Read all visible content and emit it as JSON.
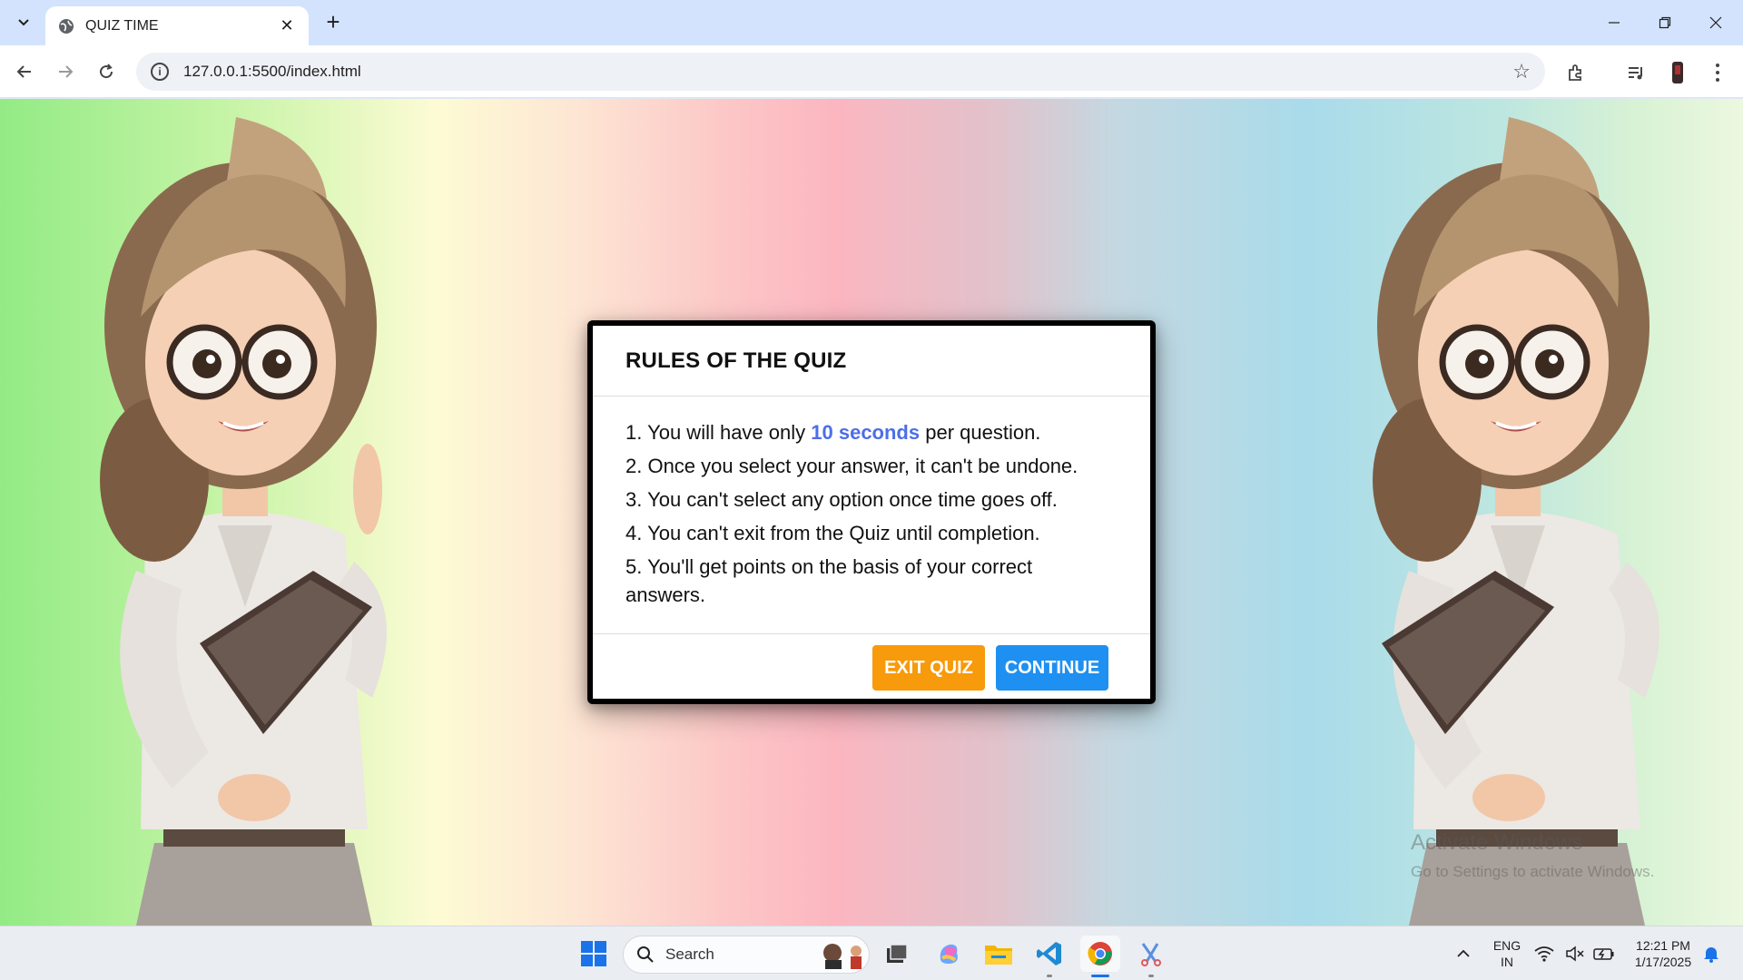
{
  "browser": {
    "tab_title": "QUIZ TIME",
    "url": "127.0.0.1:5500/index.html"
  },
  "modal": {
    "title": "RULES OF THE QUIZ",
    "rules": [
      {
        "before": "1. You will have only ",
        "highlight": "10 seconds",
        "after": " per question."
      },
      {
        "text": "2. Once you select your answer, it can't be undone."
      },
      {
        "text": "3. You can't select any option once time goes off."
      },
      {
        "text": "4. You can't exit from the Quiz until completion."
      },
      {
        "text": "5. You'll get points on the basis of your correct answers."
      }
    ],
    "exit_label": "EXIT QUIZ",
    "continue_label": "CONTINUE",
    "highlight_color": "#4c6ee8",
    "exit_color": "#f79a0b",
    "continue_color": "#1e90f1"
  },
  "watermark": {
    "line1": "Activate Windows",
    "line2": "Go to Settings to activate Windows."
  },
  "taskbar": {
    "search_placeholder": "Search",
    "lang_line1": "ENG",
    "lang_line2": "IN",
    "time": "12:21 PM",
    "date": "1/17/2025"
  }
}
